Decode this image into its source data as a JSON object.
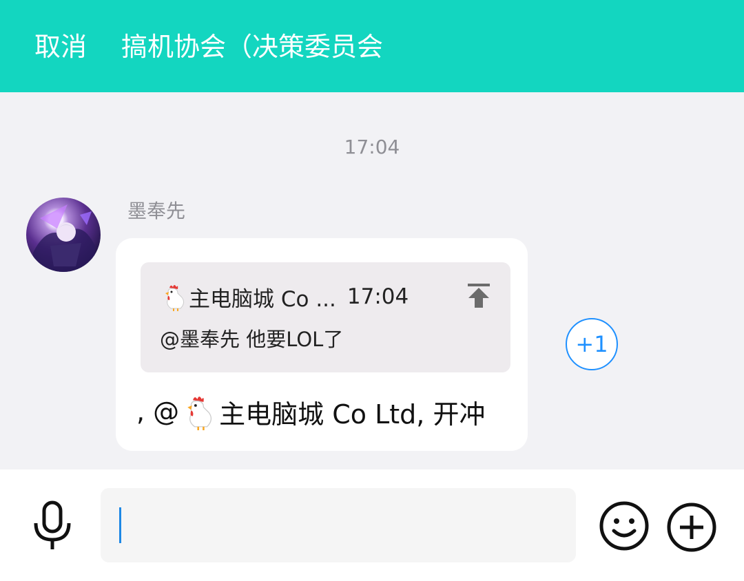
{
  "header": {
    "cancel_label": "取消",
    "title": "搞机协会（决策委员会"
  },
  "chat": {
    "timestamp": "17:04",
    "message": {
      "sender": "墨奉先",
      "quote": {
        "emoji": "rooster",
        "author": "主电脑城 Co ...",
        "time": "17:04",
        "text": "@墨奉先 他要LOL了",
        "icon": "jump-to-top-icon"
      },
      "text_prefix": ", @",
      "text_emoji": "rooster",
      "text_suffix": "主电脑城 Co Ltd, 开冲"
    },
    "reaction": "+1"
  },
  "composer": {
    "input_value": "",
    "icons": [
      "microphone-icon",
      "smiley-icon",
      "plus-circle-icon"
    ]
  },
  "colors": {
    "header_bg": "#13d6c0",
    "accent_blue": "#1e90ff",
    "chat_bg": "#f2f2f5"
  }
}
